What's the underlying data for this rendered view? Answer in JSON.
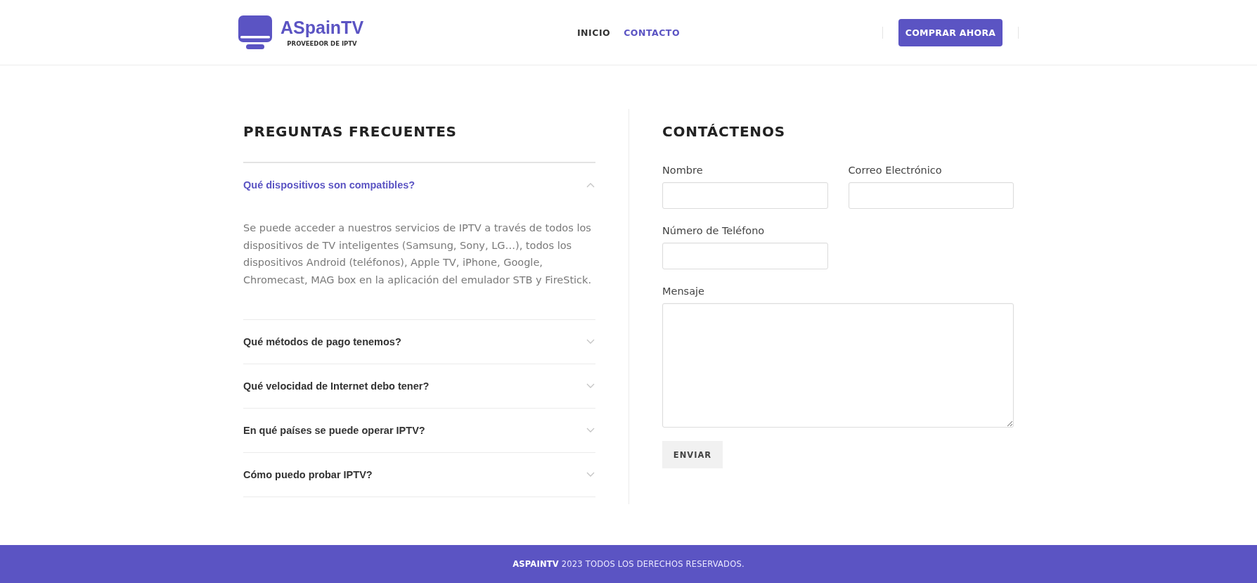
{
  "header": {
    "logo": {
      "name": "ASpainTV",
      "tagline": "PROVEEDOR DE IPTV"
    },
    "nav": [
      {
        "label": "INICIO",
        "selected": false
      },
      {
        "label": "CONTACTO",
        "selected": true
      }
    ],
    "cta_button": "COMPRAR AHORA"
  },
  "faq": {
    "title": "PREGUNTAS FRECUENTES",
    "items": [
      {
        "question": "Qué dispositivos son compatibles?",
        "expanded": true,
        "answer": "Se puede acceder a nuestros servicios de IPTV a través de todos los dispositivos de TV inteligentes (Samsung, Sony, LG…), todos los dispositivos Android (teléfonos), Apple TV, iPhone, Google, Chromecast, MAG box en la aplicación del emulador STB y FireStick."
      },
      {
        "question": "Qué métodos de pago tenemos?",
        "expanded": false
      },
      {
        "question": "Qué velocidad de Internet debo tener?",
        "expanded": false
      },
      {
        "question": "En qué países se puede operar IPTV?",
        "expanded": false
      },
      {
        "question": "Cómo puedo probar IPTV?",
        "expanded": false
      }
    ]
  },
  "contact": {
    "title": "CONTÁCTENOS",
    "fields": [
      {
        "label": "Nombre",
        "kind": "input"
      },
      {
        "label": "Correo Electrónico",
        "kind": "input"
      },
      {
        "label": "Número de Teléfono",
        "kind": "input"
      },
      {
        "label": "Mensaje",
        "kind": "textarea"
      }
    ],
    "submit": "ENVIAR"
  },
  "footer": {
    "text": "**ASPAINTV** 2023 TODOS LOS DERECHOS RESERVADOS."
  }
}
